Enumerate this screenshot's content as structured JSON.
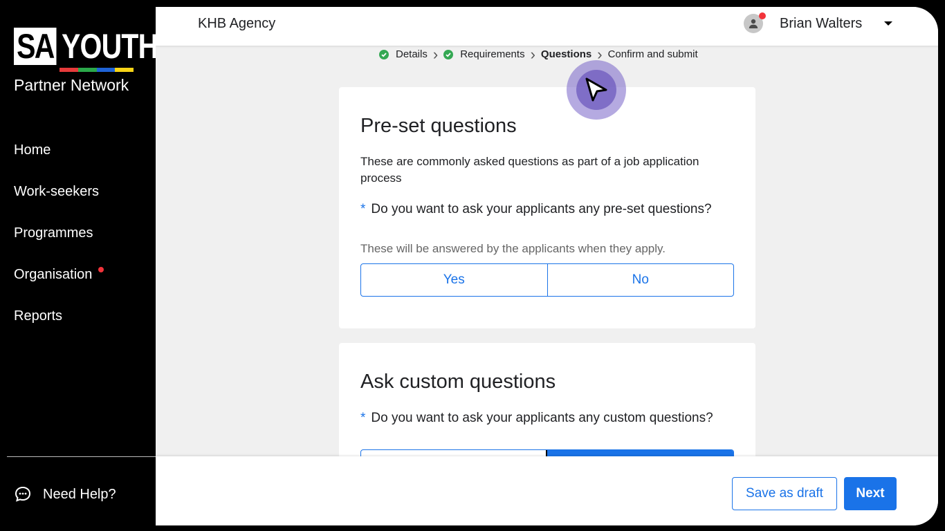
{
  "sidebar": {
    "logo": {
      "left": "SA",
      "right": "YOUTH",
      "subtitle": "Partner Network",
      "bar_colors": [
        "#e63b3b",
        "#2ba84a",
        "#1f63d6",
        "#f7d417"
      ]
    },
    "items": [
      {
        "label": "Home"
      },
      {
        "label": "Work-seekers"
      },
      {
        "label": "Programmes"
      },
      {
        "label": "Organisation",
        "has_notification": true
      },
      {
        "label": "Reports"
      }
    ],
    "help_label": "Need Help?"
  },
  "header": {
    "agency": "KHB Agency",
    "user_name": "Brian Walters"
  },
  "steps": [
    {
      "label": "Details",
      "state": "done"
    },
    {
      "label": "Requirements",
      "state": "done"
    },
    {
      "label": "Questions",
      "state": "active"
    },
    {
      "label": "Confirm and submit",
      "state": "pending"
    }
  ],
  "preset": {
    "title": "Pre-set questions",
    "description": "These are commonly asked questions as part of a job application process",
    "question": "Do you want to ask your applicants any pre-set questions?",
    "hint": "These will be answered by the applicants when they apply.",
    "yes_label": "Yes",
    "no_label": "No"
  },
  "custom": {
    "title": "Ask custom questions",
    "question": "Do you want to ask your applicants any custom questions?"
  },
  "footer": {
    "save_draft_label": "Save as draft",
    "next_label": "Next"
  },
  "colors": {
    "accent": "#1a73e8",
    "success": "#34a853",
    "notification": "#f2333a"
  }
}
